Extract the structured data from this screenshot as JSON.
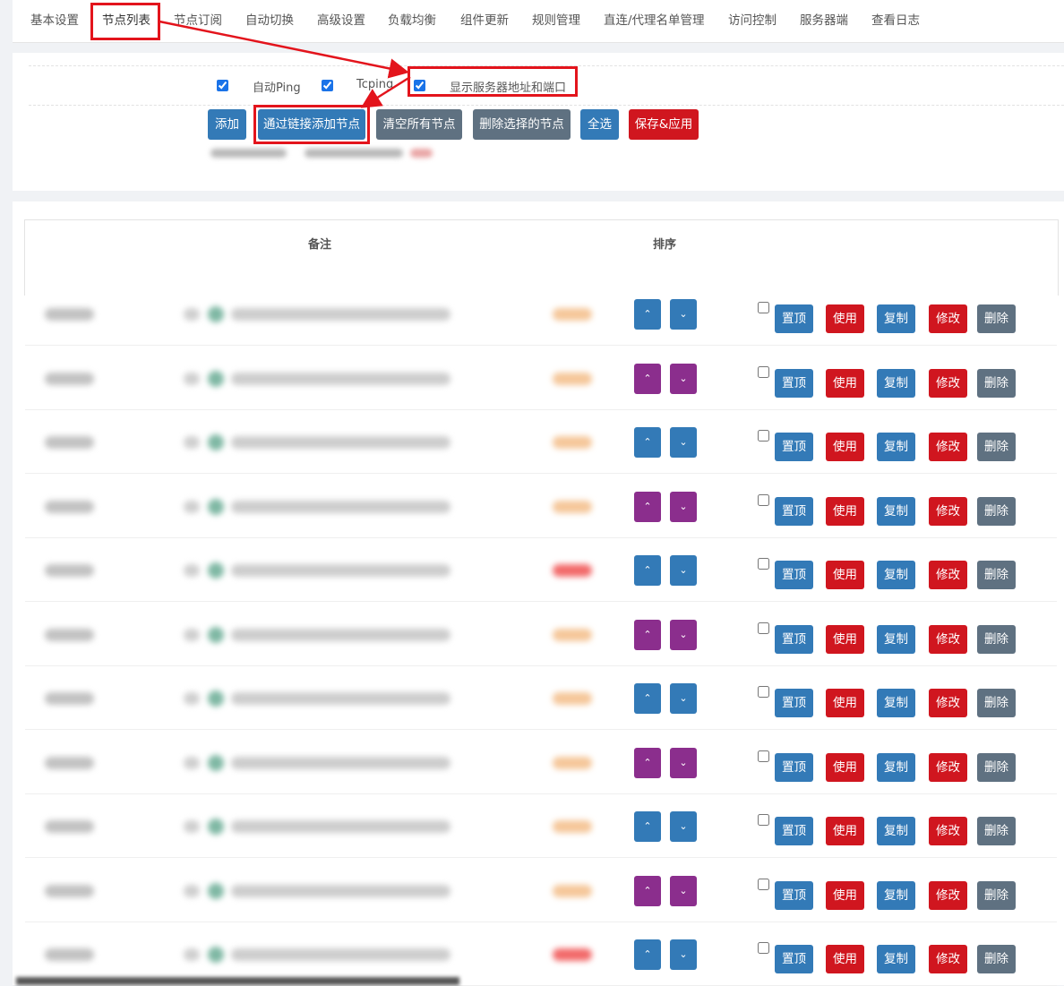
{
  "tabs": [
    "基本设置",
    "节点列表",
    "节点订阅",
    "自动切换",
    "高级设置",
    "负载均衡",
    "组件更新",
    "规则管理",
    "直连/代理名单管理",
    "访问控制",
    "服务器端",
    "查看日志"
  ],
  "options": {
    "auto_ping": {
      "label": "自动Ping",
      "checked": true
    },
    "tcping": {
      "label": "Tcping",
      "checked": true
    },
    "show_address": {
      "label": "显示服务器地址和端口",
      "checked": true
    }
  },
  "toolbar": {
    "add": "添加",
    "add_by_link": "通过链接添加节点",
    "clear_all": "清空所有节点",
    "delete_selected": "删除选择的节点",
    "select_all": "全选",
    "save_apply": "保存&应用"
  },
  "table": {
    "headers": {
      "remark": "备注",
      "sort": "排序"
    },
    "row_count": 11,
    "row_actions": {
      "top": "置顶",
      "use": "使用",
      "copy": "复制",
      "edit": "修改",
      "delete": "删除"
    },
    "sort_icons": {
      "up": "chevron-up-icon",
      "down": "chevron-down-icon"
    },
    "sort_colors": [
      "#337ab7",
      "#8b2e8d"
    ]
  },
  "colors": {
    "primary": "#337ab7",
    "danger": "#d0161f",
    "secondary": "#5f7181",
    "purple": "#8b2e8d",
    "annotation": "#e3141c"
  }
}
